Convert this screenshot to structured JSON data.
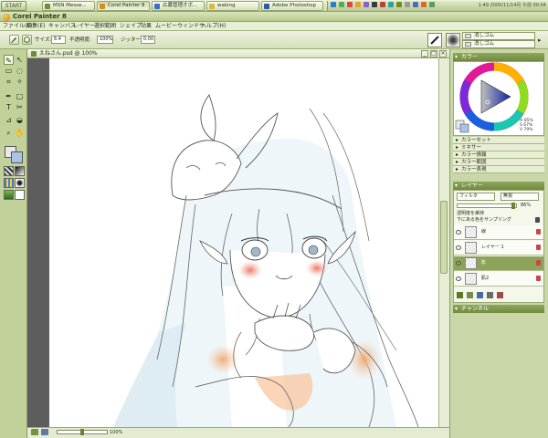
{
  "taskbar": {
    "start_label": "START",
    "tasks": [
      {
        "label": "MSN Messe..."
      },
      {
        "label": "Corel Painter 8"
      },
      {
        "label": "広募管理才ボ..."
      },
      {
        "label": "waking"
      },
      {
        "label": "Adobe Photoshop"
      }
    ],
    "clock": "1:49 2005/11/14月 午前 00:04"
  },
  "app": {
    "title": "Corel Painter 8"
  },
  "menu": [
    "ファイル(F)",
    "編集(E)",
    "キャンバス",
    "レイヤー",
    "選択範囲",
    "シェイプ",
    "効果",
    "ムービー",
    "ウィンドウ",
    "ヘルプ(H)"
  ],
  "propbar": {
    "size_label": "サイズ:",
    "size_value": "6.4",
    "opacity_label": "不透明度:",
    "opacity_value": "100%",
    "jitter_label": "ジッター:",
    "jitter_value": "0.00",
    "brush_category": "消しゴム",
    "brush_variant": "消しゴム"
  },
  "document": {
    "title": "えねさん.psd @ 100%",
    "zoom": "100%"
  },
  "panels": {
    "color_header": "カラー",
    "hsv": [
      "H 85%",
      "S 67%",
      "V 79%"
    ],
    "collapsed": [
      "カラーセット",
      "ミキサー",
      "カラー情報",
      "カラー範囲",
      "カラー表現"
    ],
    "layers_header": "レイヤー",
    "composite_method": "フィルタ",
    "composite_depth": "無視",
    "opacity_value": "86%",
    "preserve_label": "透明度を維持",
    "sample_label": "下にある色をサンプリング",
    "layers": [
      {
        "name": "線",
        "selected": false
      },
      {
        "name": "レイヤー 1",
        "selected": false
      },
      {
        "name": "影",
        "selected": true
      },
      {
        "name": "肌2",
        "selected": false
      }
    ],
    "channel_header": "チャンネル"
  },
  "colors": {
    "accent": "#8ea35a",
    "main_color": "#e8e8e8",
    "additional_color": "#a7c3e5"
  }
}
